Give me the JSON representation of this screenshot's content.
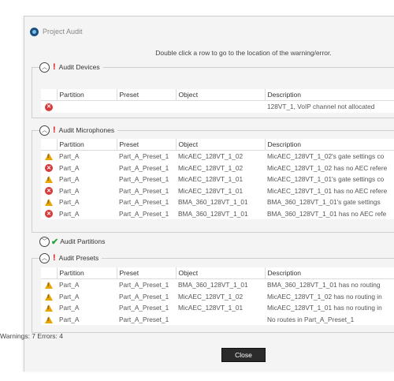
{
  "window": {
    "title": "Project Audit",
    "instruction": "Double click a row to go to the location of the warning/error."
  },
  "groups": {
    "devices": {
      "title": "Audit Devices",
      "status": "error",
      "expanded": true,
      "columns": [
        "",
        "Partition",
        "Preset",
        "Object",
        "Description"
      ],
      "rows": [
        {
          "type": "error",
          "partition": "",
          "preset": "",
          "object": "",
          "description": "128VT_1, VoIP channel not allocated"
        }
      ]
    },
    "microphones": {
      "title": "Audit Microphones",
      "status": "error",
      "expanded": true,
      "columns": [
        "",
        "Partition",
        "Preset",
        "Object",
        "Description"
      ],
      "rows": [
        {
          "type": "warning",
          "partition": "Part_A",
          "preset": "Part_A_Preset_1",
          "object": "MicAEC_128VT_1_02",
          "description": "MicAEC_128VT_1_02's gate settings co"
        },
        {
          "type": "error",
          "partition": "Part_A",
          "preset": "Part_A_Preset_1",
          "object": "MicAEC_128VT_1_02",
          "description": "MicAEC_128VT_1_02 has no AEC refere"
        },
        {
          "type": "warning",
          "partition": "Part_A",
          "preset": "Part_A_Preset_1",
          "object": "MicAEC_128VT_1_01",
          "description": "MicAEC_128VT_1_01's gate settings co"
        },
        {
          "type": "error",
          "partition": "Part_A",
          "preset": "Part_A_Preset_1",
          "object": "MicAEC_128VT_1_01",
          "description": "MicAEC_128VT_1_01 has no AEC refere"
        },
        {
          "type": "warning",
          "partition": "Part_A",
          "preset": "Part_A_Preset_1",
          "object": "BMA_360_128VT_1_01",
          "description": "BMA_360_128VT_1_01's gate settings"
        },
        {
          "type": "error",
          "partition": "Part_A",
          "preset": "Part_A_Preset_1",
          "object": "BMA_360_128VT_1_01",
          "description": "BMA_360_128VT_1_01 has no AEC refe"
        }
      ]
    },
    "partitions": {
      "title": "Audit Partitions",
      "status": "ok",
      "expanded": false
    },
    "presets": {
      "title": "Audit Presets",
      "status": "error",
      "expanded": true,
      "columns": [
        "",
        "Partition",
        "Preset",
        "Object",
        "Description"
      ],
      "rows": [
        {
          "type": "warning",
          "partition": "Part_A",
          "preset": "Part_A_Preset_1",
          "object": "BMA_360_128VT_1_01",
          "description": "BMA_360_128VT_1_01 has no routing"
        },
        {
          "type": "warning",
          "partition": "Part_A",
          "preset": "Part_A_Preset_1",
          "object": "MicAEC_128VT_1_02",
          "description": "MicAEC_128VT_1_02 has no routing in"
        },
        {
          "type": "warning",
          "partition": "Part_A",
          "preset": "Part_A_Preset_1",
          "object": "MicAEC_128VT_1_01",
          "description": "MicAEC_128VT_1_01 has no routing in"
        },
        {
          "type": "warning",
          "partition": "Part_A",
          "preset": "Part_A_Preset_1",
          "object": "",
          "description": "No routes in Part_A_Preset_1"
        }
      ]
    }
  },
  "footer": {
    "summary": "Warnings: 7   Errors: 4",
    "close_label": "Close"
  },
  "colors": {
    "warning": "#e9a400",
    "error": "#d63a3a",
    "ok": "#27a13a",
    "button": "#2b2b2b"
  }
}
